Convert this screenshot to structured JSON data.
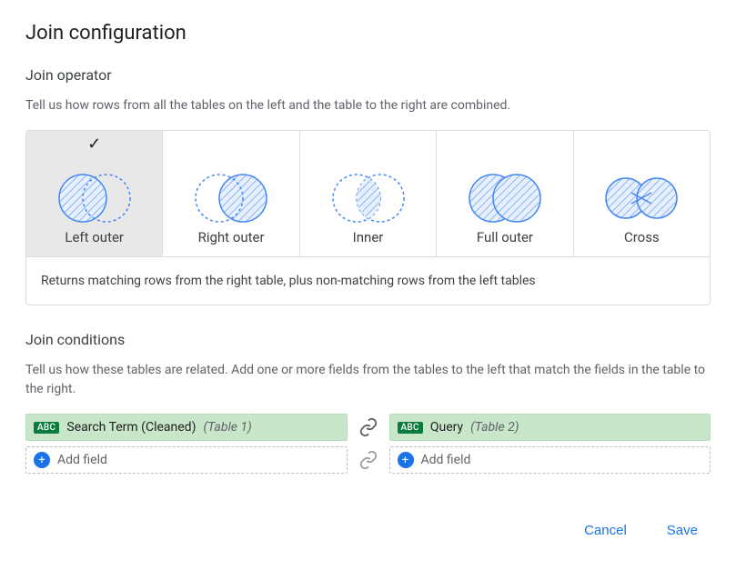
{
  "title": "Join configuration",
  "operator_section": {
    "heading": "Join operator",
    "help": "Tell us how rows from all the tables on the left and the table to the right are combined.",
    "options": [
      {
        "key": "left_outer",
        "label": "Left outer",
        "selected": true
      },
      {
        "key": "right_outer",
        "label": "Right outer",
        "selected": false
      },
      {
        "key": "inner",
        "label": "Inner",
        "selected": false
      },
      {
        "key": "full_outer",
        "label": "Full outer",
        "selected": false
      },
      {
        "key": "cross",
        "label": "Cross",
        "selected": false
      }
    ],
    "selected_description": "Returns matching rows from the right table, plus non-matching rows from the left tables"
  },
  "conditions_section": {
    "heading": "Join conditions",
    "help": "Tell us how these tables are related. Add one or more fields from the tables to the left that match the fields in the table to the right.",
    "rows": [
      {
        "left": {
          "type_label": "ABC",
          "field": "Search Term (Cleaned)",
          "table": "(Table 1)"
        },
        "right": {
          "type_label": "ABC",
          "field": "Query",
          "table": "(Table 2)"
        }
      }
    ],
    "add_label": "Add field"
  },
  "actions": {
    "cancel": "Cancel",
    "save": "Save"
  }
}
